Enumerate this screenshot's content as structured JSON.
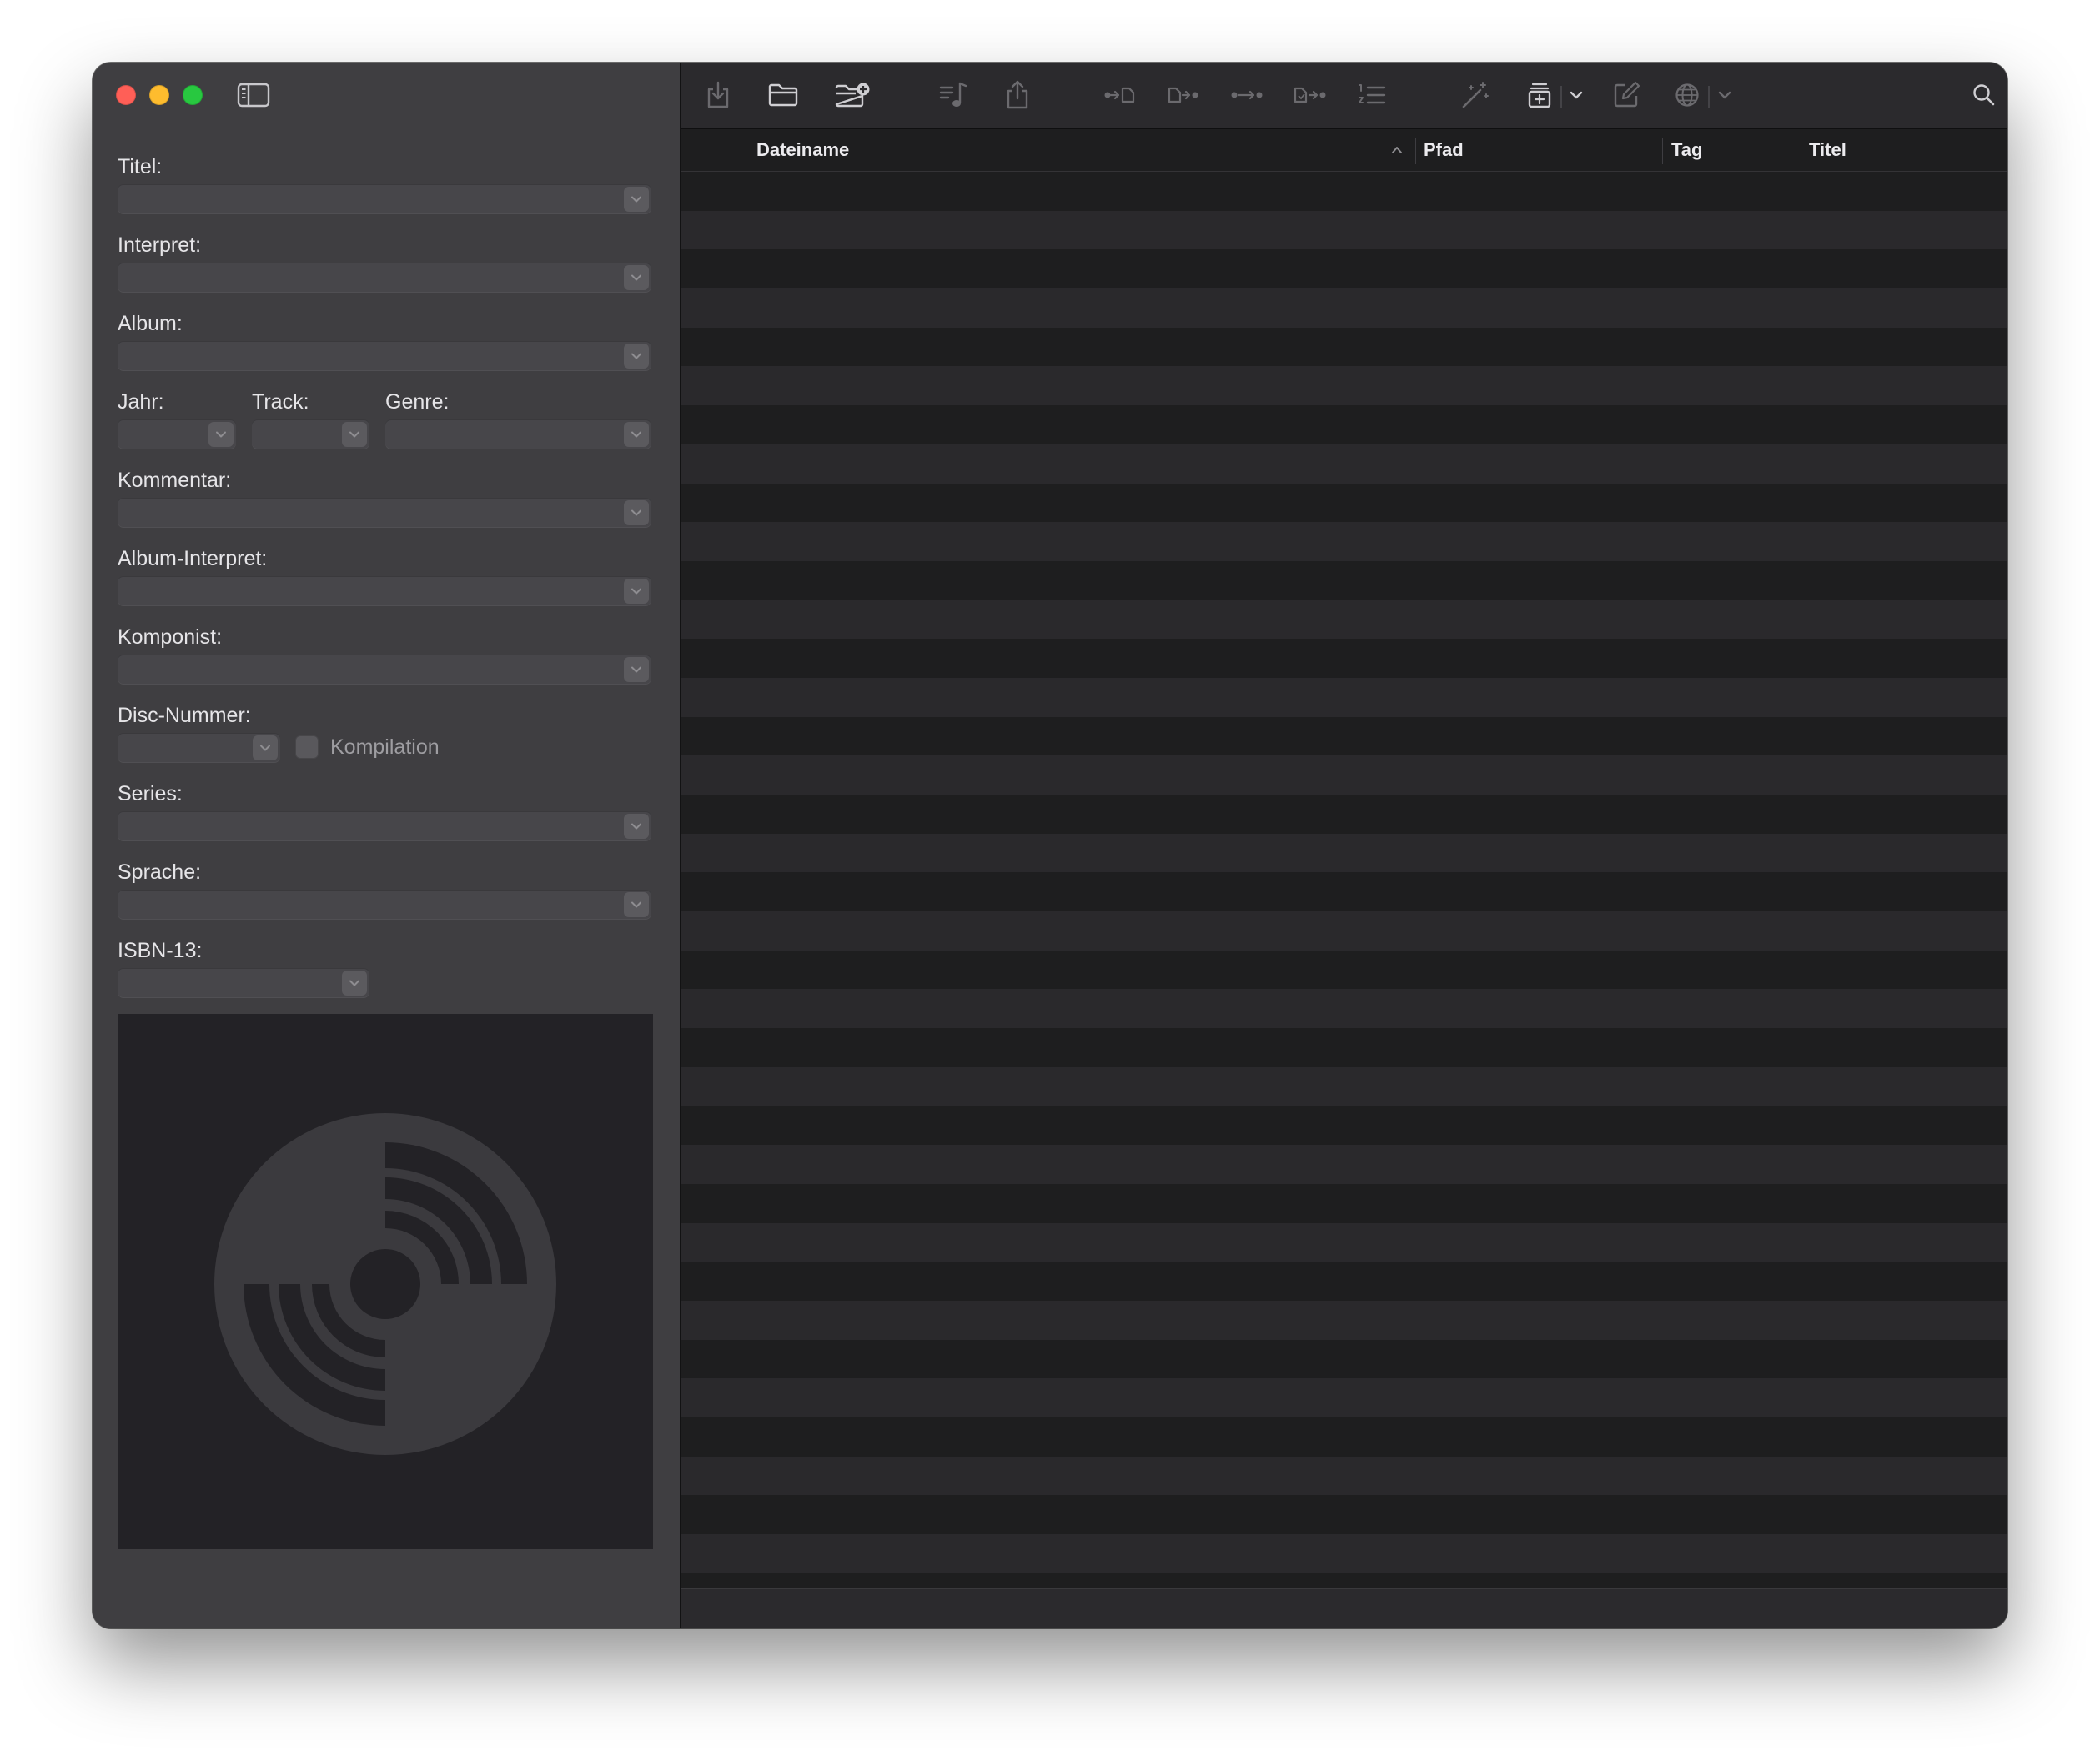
{
  "sidebar": {
    "fields": {
      "titel": "Titel:",
      "interpret": "Interpret:",
      "album": "Album:",
      "jahr": "Jahr:",
      "track": "Track:",
      "genre": "Genre:",
      "kommentar": "Kommentar:",
      "album_interpret": "Album-Interpret:",
      "komponist": "Komponist:",
      "disc_nummer": "Disc-Nummer:",
      "series": "Series:",
      "sprache": "Sprache:",
      "isbn": "ISBN-13:"
    },
    "kompilation_label": "Kompilation",
    "kompilation_checked": false,
    "icons": {
      "sidebar_toggle": "sidebar-toggle-icon",
      "combo_arrow": "chevron-down-icon",
      "artwork": "music-disc-icon"
    }
  },
  "table": {
    "columns": [
      "Dateiname",
      "Pfad",
      "Tag",
      "Titel"
    ],
    "sort_column": "Dateiname",
    "sort_direction": "ascending",
    "rows": []
  },
  "toolbar": {
    "icons": [
      "import-icon",
      "open-folder-icon",
      "add-folder-icon",
      "playlist-icon",
      "share-icon",
      "tag-to-filename-icon",
      "filename-to-tag-icon",
      "tag-to-tag-icon",
      "file-to-tag-icon",
      "numbering-icon",
      "magic-wand-icon",
      "copy-tags-icon",
      "chevron-down-icon",
      "edit-icon",
      "globe-icon",
      "chevron-down-icon",
      "search-icon"
    ]
  },
  "colors": {
    "sidebar_bg": "#3f3e41",
    "table_row_odd": "#1e1e1f",
    "table_row_even": "#2a292c",
    "close": "#ff5f57",
    "minimize": "#febc2e",
    "maximize": "#28c840"
  }
}
